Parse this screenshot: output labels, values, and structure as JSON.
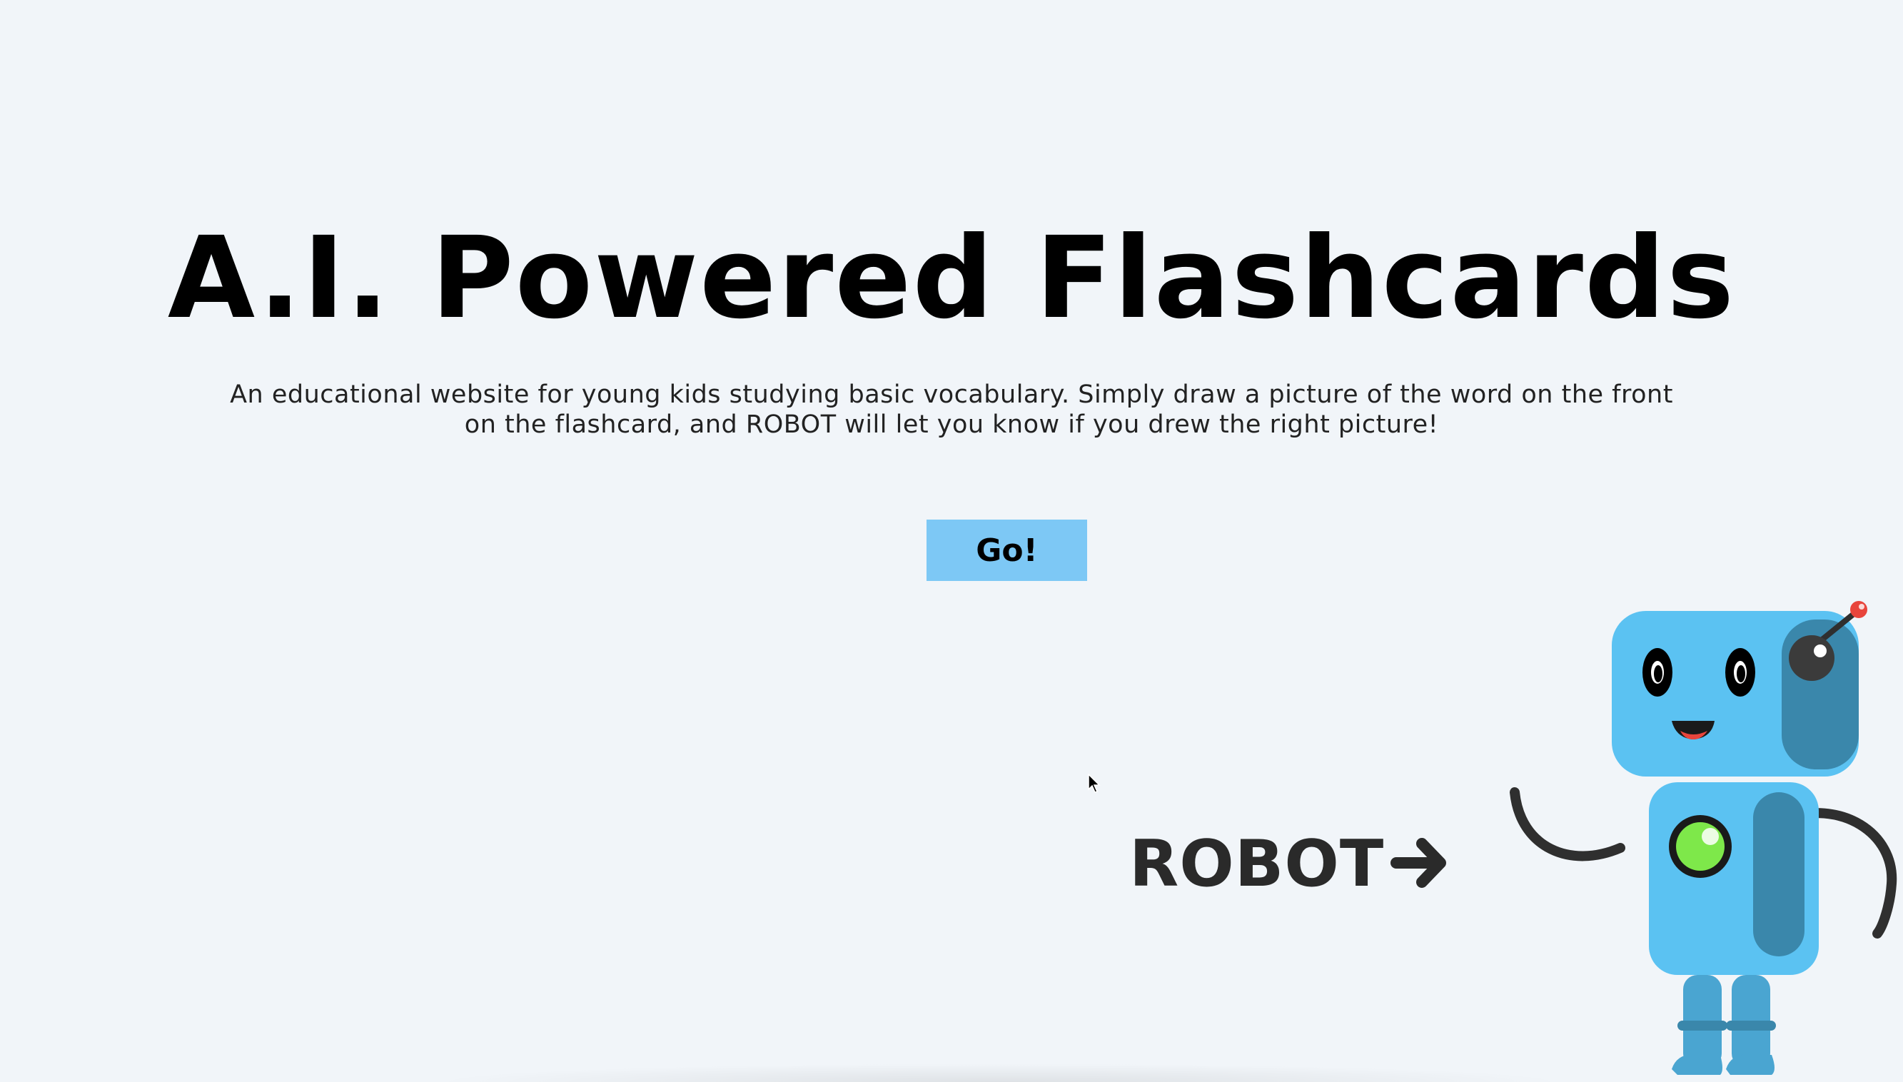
{
  "hero": {
    "title": "A.I. Powered Flashcards",
    "description": "An educational website for young kids studying basic vocabulary. Simply draw a picture of the word on the front on the flashcard, and ROBOT will let you know if you drew the right picture!",
    "go_label": "Go!"
  },
  "robot_callout": {
    "label": "ROBOT",
    "arrow_icon": "arrow-right-icon",
    "illustration": "robot-mascot"
  },
  "colors": {
    "background": "#f1f5f9",
    "button": "#7dc8f5",
    "robot_body": "#5bc2f2",
    "robot_shade": "#3a87ab",
    "robot_light": "#7ee84a",
    "antenna_tip": "#e8453c"
  }
}
